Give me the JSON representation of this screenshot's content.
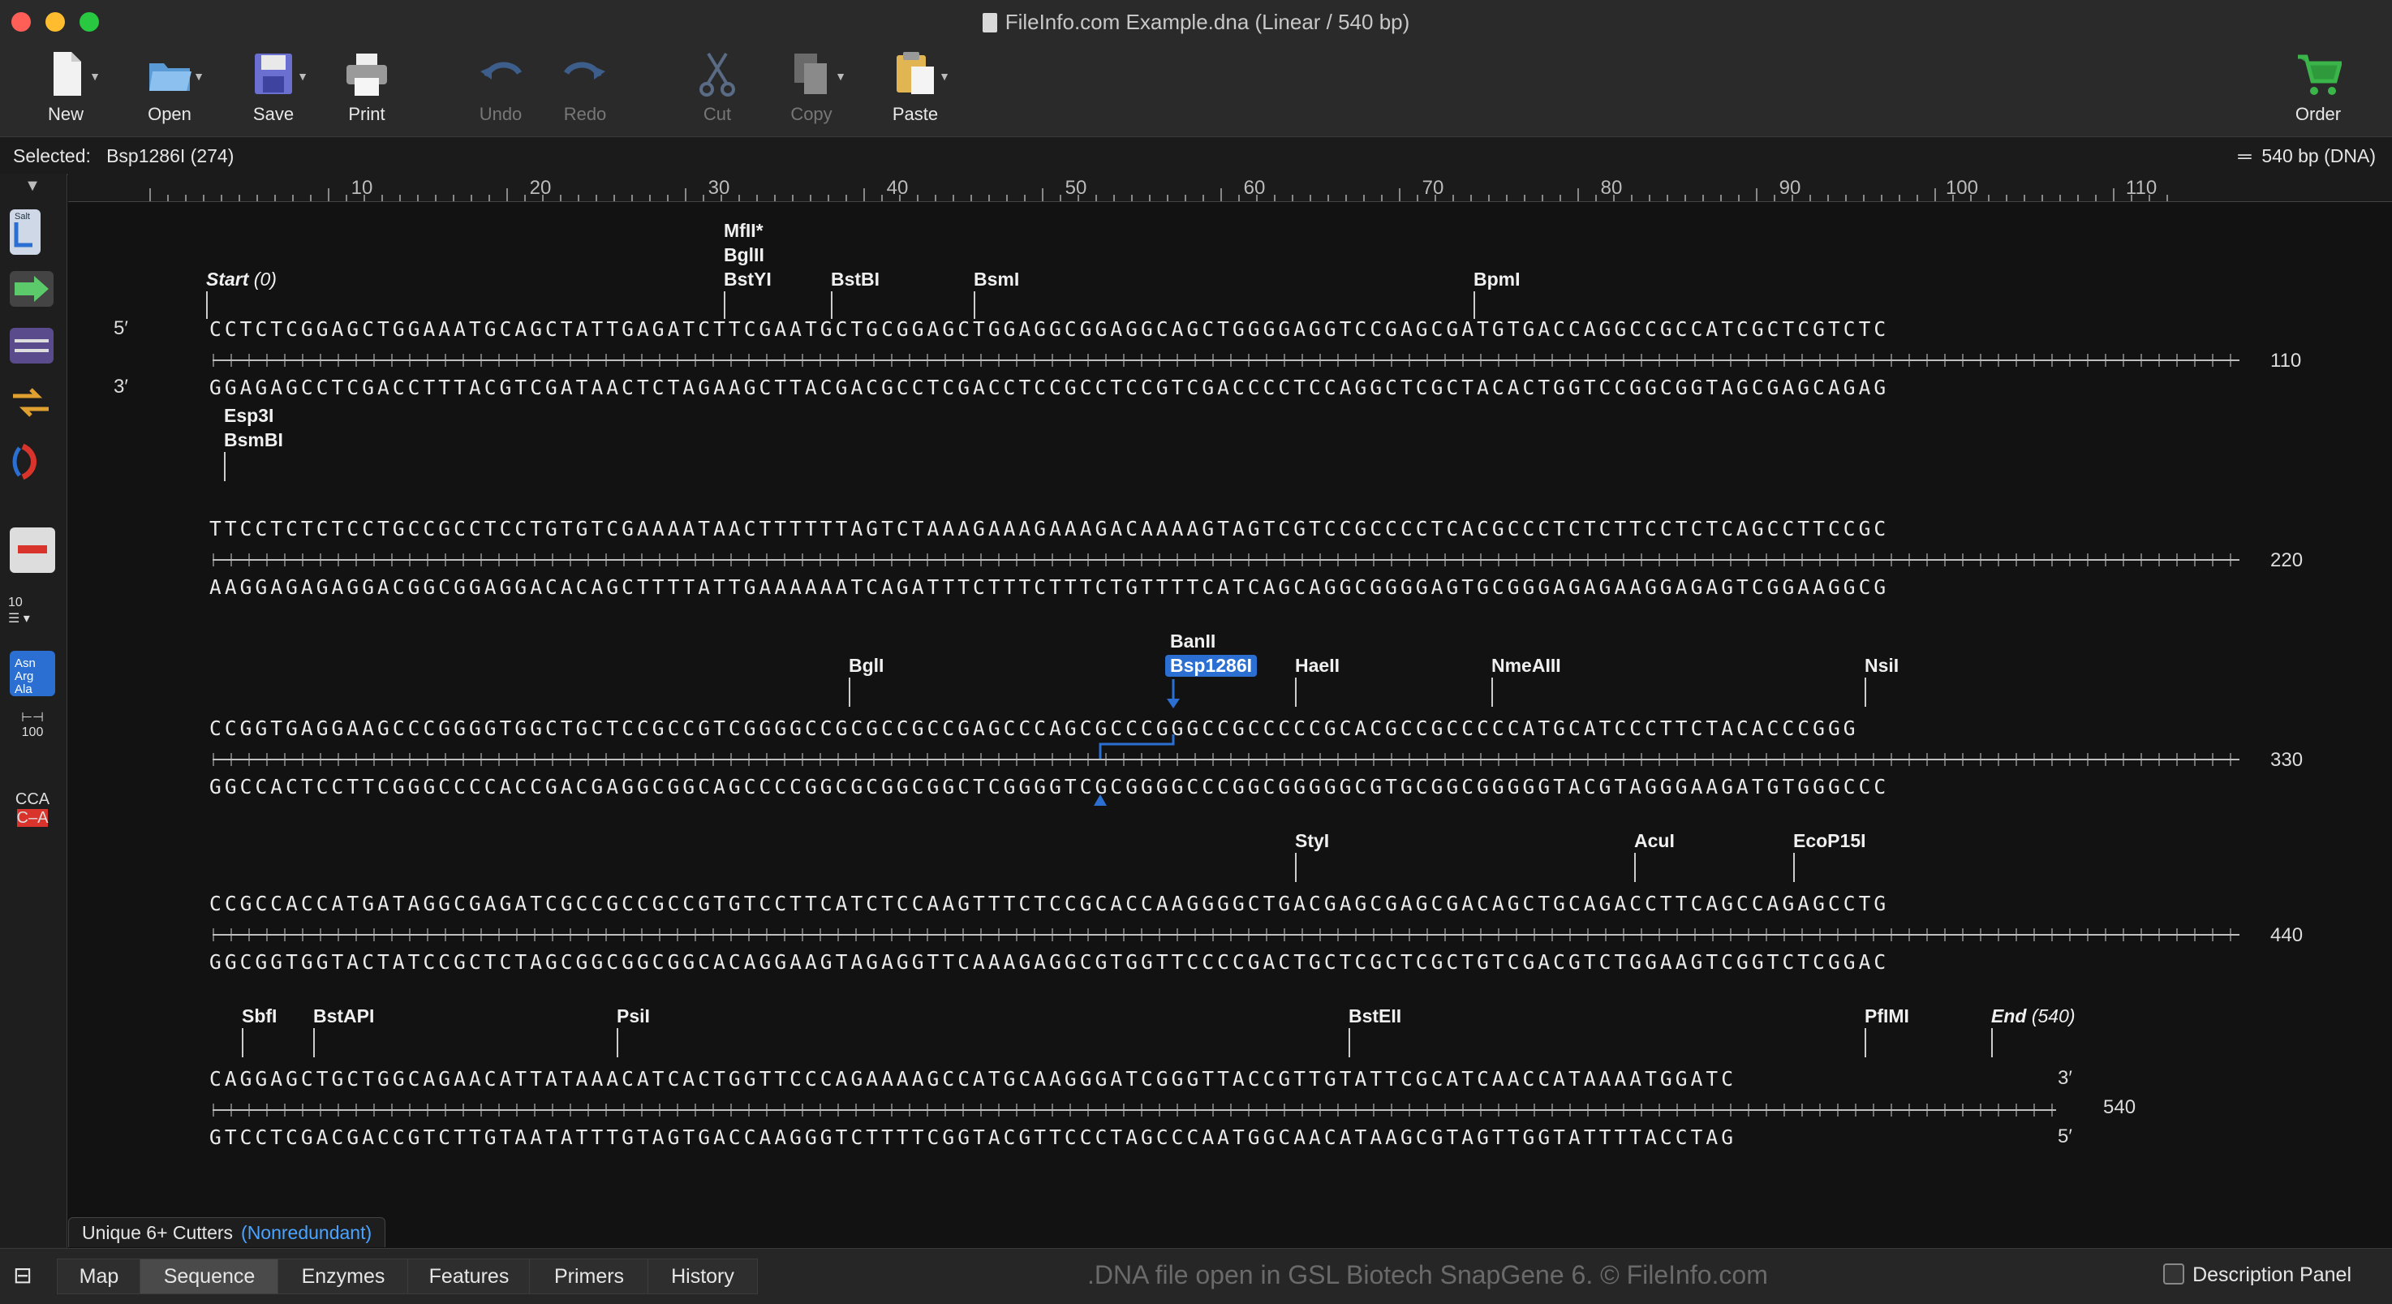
{
  "window": {
    "title": "FileInfo.com Example.dna  (Linear / 540 bp)"
  },
  "toolbar": {
    "new": "New",
    "open": "Open",
    "save": "Save",
    "print": "Print",
    "undo": "Undo",
    "redo": "Redo",
    "cut": "Cut",
    "copy": "Copy",
    "paste": "Paste",
    "order": "Order"
  },
  "selection": {
    "label": "Selected:",
    "value": "Bsp1286I (274)",
    "length": "540 bp  (DNA)"
  },
  "ruler": {
    "labels": [
      "10",
      "20",
      "30",
      "40",
      "50",
      "60",
      "70",
      "80",
      "90",
      "100",
      "110"
    ]
  },
  "strand_labels": {
    "five": "5′",
    "three": "3′"
  },
  "rows": [
    {
      "top": "CCTCTCGGAGCTGGAAATGCAGCTATTGAGATCTTCGAATGCTGCGGAGCTGGAGGCGGAGGCAGCTGGGGAGGTCCGAGCGATGTGACCAGGCCGCCATCGCTCGTCTC",
      "bottom": "GGAGAGCCTCGACCTTTACGTCGATAACTCTAGAAGCTTACGACGCCTCGACCTCCGCCTCCGTCGACCCCTCCAGGCTCGCTACACTGGTCCGGCGGTAGCGAGCAGAG",
      "number": "110",
      "enzymes": [
        "MfII*",
        "BglII",
        "BstYI",
        "BstBI",
        "BsmI",
        "BpmI"
      ],
      "start_label": "Start",
      "start_pos": "(0)"
    },
    {
      "top": "TTCCTCTCTCCTGCCGCCTCCTGTGTCGAAAATAACTTTTTTAGTCTAAAGAAAGAAAGACAAAAGTAGTCGTCCGCCCCTCACGCCCTCTCTTCCTCTCAGCCTTCCGC",
      "bottom": "AAGGAGAGAGGACGGCGGAGGACACAGCTTTTATTGAAAAAATCAGATTTCTTTCTTTCTGTTTTCATCAGCAGGCGGGGAGTGCGGGAGAGAAGGAGAGTCGGAAGGCG",
      "number": "220",
      "enzymes": [
        "Esp3I",
        "BsmBI"
      ]
    },
    {
      "top": "CCGGTGAGGAAGCCCGGGGTGGCTGCTCCGCCGTCGGGGCCGCGCCGCCGAGCCCAGCGCCCGGGCCGCCCCCGCACGCCGCCCCCATGCATCCCTTCTACACCCGGG",
      "bottom": "GGCCACTCCTTCGGGCCCCACCGACGAGGCGGCAGCCCCGGCGCGGCGGCTCGGGGTCGCGGGGCCCGGCGGGGGCGTGCGGCGGGGGTACGTAGGGAAGATGTGGGCCC",
      "number": "330",
      "enzymes": [
        "BglI",
        "BanII",
        "Bsp1286I",
        "HaeII",
        "NmeAIII",
        "NsiI"
      ]
    },
    {
      "top": "CCGCCACCATGATAGGCGAGATCGCCGCCGCCGTGTCCTTCATCTCCAAGTTTCTCCGCACCAAGGGGCTGACGAGCGAGCGACAGCTGCAGACCTTCAGCCAGAGCCTG",
      "bottom": "GGCGGTGGTACTATCCGCTCTAGCGGCGGCGGCACAGGAAGTAGAGGTTCAAAGAGGCGTGGTTCCCCGACTGCTCGCTCGCTGTCGACGTCTGGAAGTCGGTCTCGGAC",
      "number": "440",
      "enzymes": [
        "StyI",
        "AcuI",
        "EcoP15I"
      ]
    },
    {
      "top": "CAGGAGCTGCTGGCAGAACATTATAAACATCACTGGTTCCCAGAAAAGCCATGCAAGGGATCGGGTTACCGTTGTATTCGCATCAACCATAAAATGGATC",
      "bottom": "GTCCTCGACGACCGTCTTGTAATATTTGTAGTGACCAAGGGTCTTTTCGGTACGTTCCCTAGCCCAATGGCAACATAAGCGTAGTTGGTATTTTACCTAG",
      "number": "540",
      "enzymes": [
        "SbfI",
        "BstAPI",
        "PsiI",
        "BstEII",
        "PfIMI"
      ],
      "end_label": "End",
      "end_pos": "(540)"
    }
  ],
  "enzyme_set": {
    "name": "Unique 6+ Cutters",
    "mode": "(Nonredundant)"
  },
  "tabs": [
    "Map",
    "Sequence",
    "Enzymes",
    "Features",
    "Primers",
    "History"
  ],
  "active_tab": "Sequence",
  "status_text": ".DNA file open in GSL Biotech SnapGene 6. © FileInfo.com",
  "description_panel": "Description Panel",
  "colors": {
    "accent": "#2a6fd1",
    "background": "#121212"
  }
}
